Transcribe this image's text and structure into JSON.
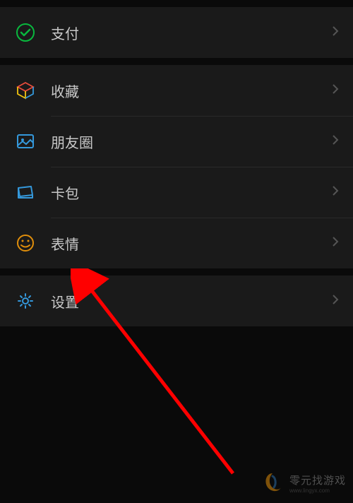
{
  "groups": [
    {
      "items": [
        {
          "id": "pay",
          "label": "支付",
          "icon": "wechat-pay-icon"
        }
      ]
    },
    {
      "items": [
        {
          "id": "favorites",
          "label": "收藏",
          "icon": "cube-icon"
        },
        {
          "id": "moments",
          "label": "朋友圈",
          "icon": "image-icon"
        },
        {
          "id": "cards",
          "label": "卡包",
          "icon": "wallet-icon"
        },
        {
          "id": "stickers",
          "label": "表情",
          "icon": "smiley-icon"
        }
      ]
    },
    {
      "items": [
        {
          "id": "settings",
          "label": "设置",
          "icon": "gear-icon"
        }
      ]
    }
  ],
  "watermark": {
    "main": "零元找游戏",
    "sub": "www.lingyx.com"
  }
}
